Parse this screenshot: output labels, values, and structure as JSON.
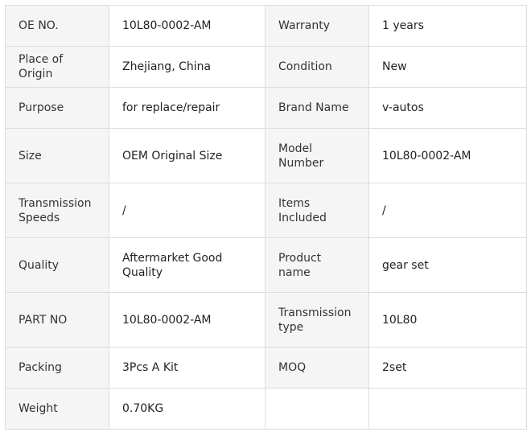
{
  "specs": {
    "rows": [
      [
        {
          "label": "OE NO.",
          "value": "10L80-0002-AM"
        },
        {
          "label": "Warranty",
          "value": "1 years"
        }
      ],
      [
        {
          "label": "Place of Origin",
          "value": "Zhejiang, China"
        },
        {
          "label": "Condition",
          "value": "New"
        }
      ],
      [
        {
          "label": "Purpose",
          "value": "for replace/repair"
        },
        {
          "label": "Brand Name",
          "value": "v-autos"
        }
      ],
      [
        {
          "label": "Size",
          "value": "OEM Original Size"
        },
        {
          "label": "Model Number",
          "value": "10L80-0002-AM"
        }
      ],
      [
        {
          "label": "Transmission Speeds",
          "value": "/"
        },
        {
          "label": "Items Included",
          "value": "/"
        }
      ],
      [
        {
          "label": "Quality",
          "value": "Aftermarket Good Quality"
        },
        {
          "label": "Product name",
          "value": "gear set"
        }
      ],
      [
        {
          "label": "PART NO",
          "value": "10L80-0002-AM"
        },
        {
          "label": "Transmission type",
          "value": "10L80"
        }
      ],
      [
        {
          "label": "Packing",
          "value": "3Pcs A Kit"
        },
        {
          "label": "MOQ",
          "value": "2set"
        }
      ],
      [
        {
          "label": "Weight",
          "value": "0.70KG"
        },
        {
          "label": "",
          "value": ""
        }
      ]
    ]
  }
}
